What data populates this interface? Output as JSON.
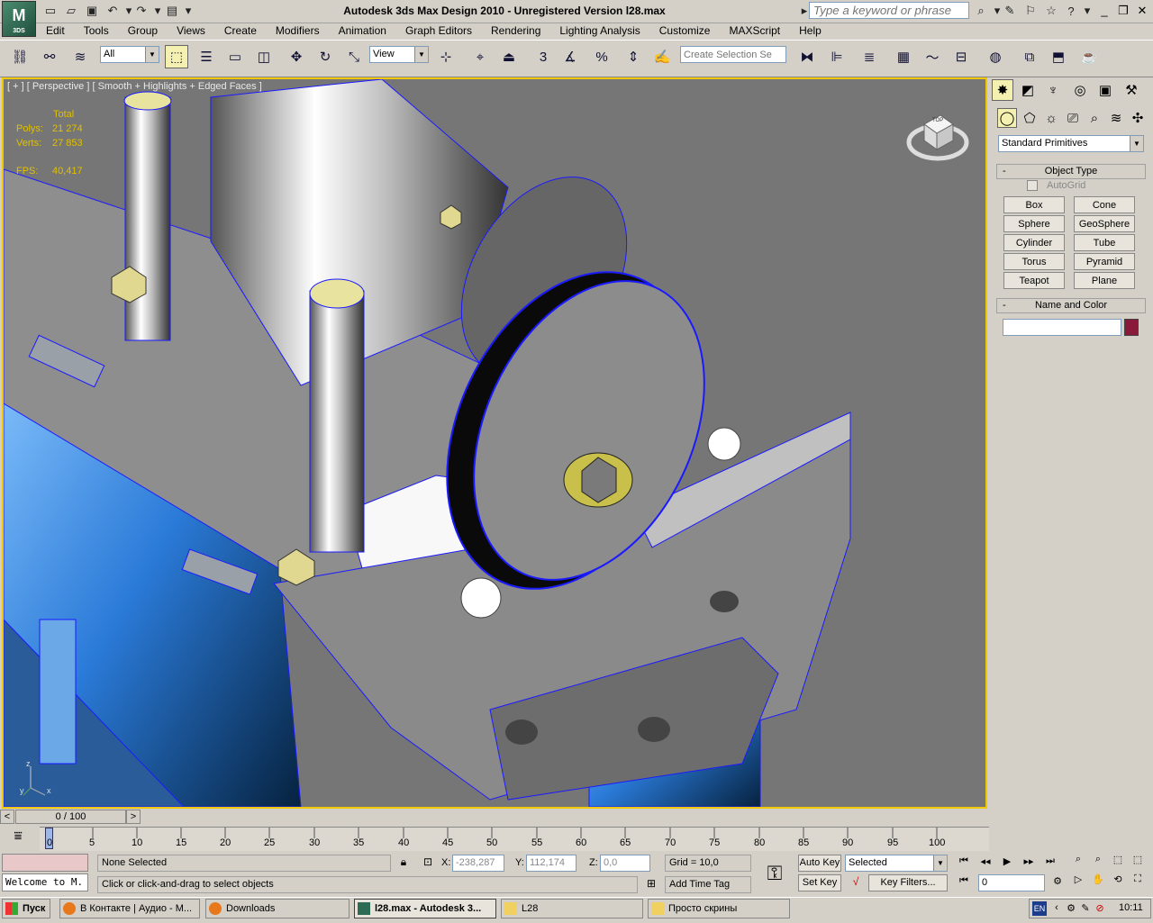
{
  "window": {
    "title": "Autodesk 3ds Max Design 2010    -  Unregistered Version      l28.max",
    "search_placeholder": "Type a keyword or phrase",
    "logo_text": "3DS"
  },
  "menu": [
    "Edit",
    "Tools",
    "Group",
    "Views",
    "Create",
    "Modifiers",
    "Animation",
    "Graph Editors",
    "Rendering",
    "Lighting Analysis",
    "Customize",
    "MAXScript",
    "Help"
  ],
  "toolbar": {
    "filter_value": "All",
    "ref_coord_value": "View",
    "snap_label": "3",
    "angle_snap_label": "%",
    "selection_set_placeholder": "Create Selection Se"
  },
  "viewport": {
    "label": "[ + ] [ Perspective ] [ Smooth + Highlights + Edged Faces ]",
    "stats_total": "Total",
    "polys_label": "Polys:",
    "polys_value": "21 274",
    "verts_label": "Verts:",
    "verts_value": "27 853",
    "fps_label": "FPS:",
    "fps_value": "40,417",
    "viewcube_label": "TOP",
    "axis_z": "z",
    "axis_x": "x",
    "axis_y": "y"
  },
  "command_panel": {
    "category": "Standard Primitives",
    "object_type_title": "Object Type",
    "autogrid_label": "AutoGrid",
    "primitives": [
      "Box",
      "Cone",
      "Sphere",
      "GeoSphere",
      "Cylinder",
      "Tube",
      "Torus",
      "Pyramid",
      "Teapot",
      "Plane"
    ],
    "name_color_title": "Name and Color",
    "object_name": "",
    "object_color": "#8a1a3a"
  },
  "timeline": {
    "frame_display": "0 / 100",
    "ticks": [
      "0",
      "5",
      "10",
      "15",
      "20",
      "25",
      "30",
      "35",
      "40",
      "45",
      "50",
      "55",
      "60",
      "65",
      "70",
      "75",
      "80",
      "85",
      "90",
      "95",
      "100"
    ]
  },
  "status": {
    "maxscript_listener": "Welcome to M.",
    "selection": "None Selected",
    "prompt": "Click or click-and-drag to select objects",
    "x_label": "X:",
    "x_value": "-238,287",
    "y_label": "Y:",
    "y_value": "112,174",
    "z_label": "Z:",
    "z_value": "0,0",
    "grid": "Grid = 10,0",
    "add_time_tag": "Add Time Tag",
    "auto_key": "Auto Key",
    "set_key": "Set Key",
    "key_mode_value": "Selected",
    "key_filters": "Key Filters...",
    "current_frame": "0"
  },
  "taskbar": {
    "start": "Пуск",
    "tasks": [
      "В Контакте | Аудио - М...",
      "Downloads",
      "l28.max - Autodesk 3...",
      "L28",
      "Просто скрины"
    ],
    "language": "EN",
    "clock": "10:11"
  }
}
